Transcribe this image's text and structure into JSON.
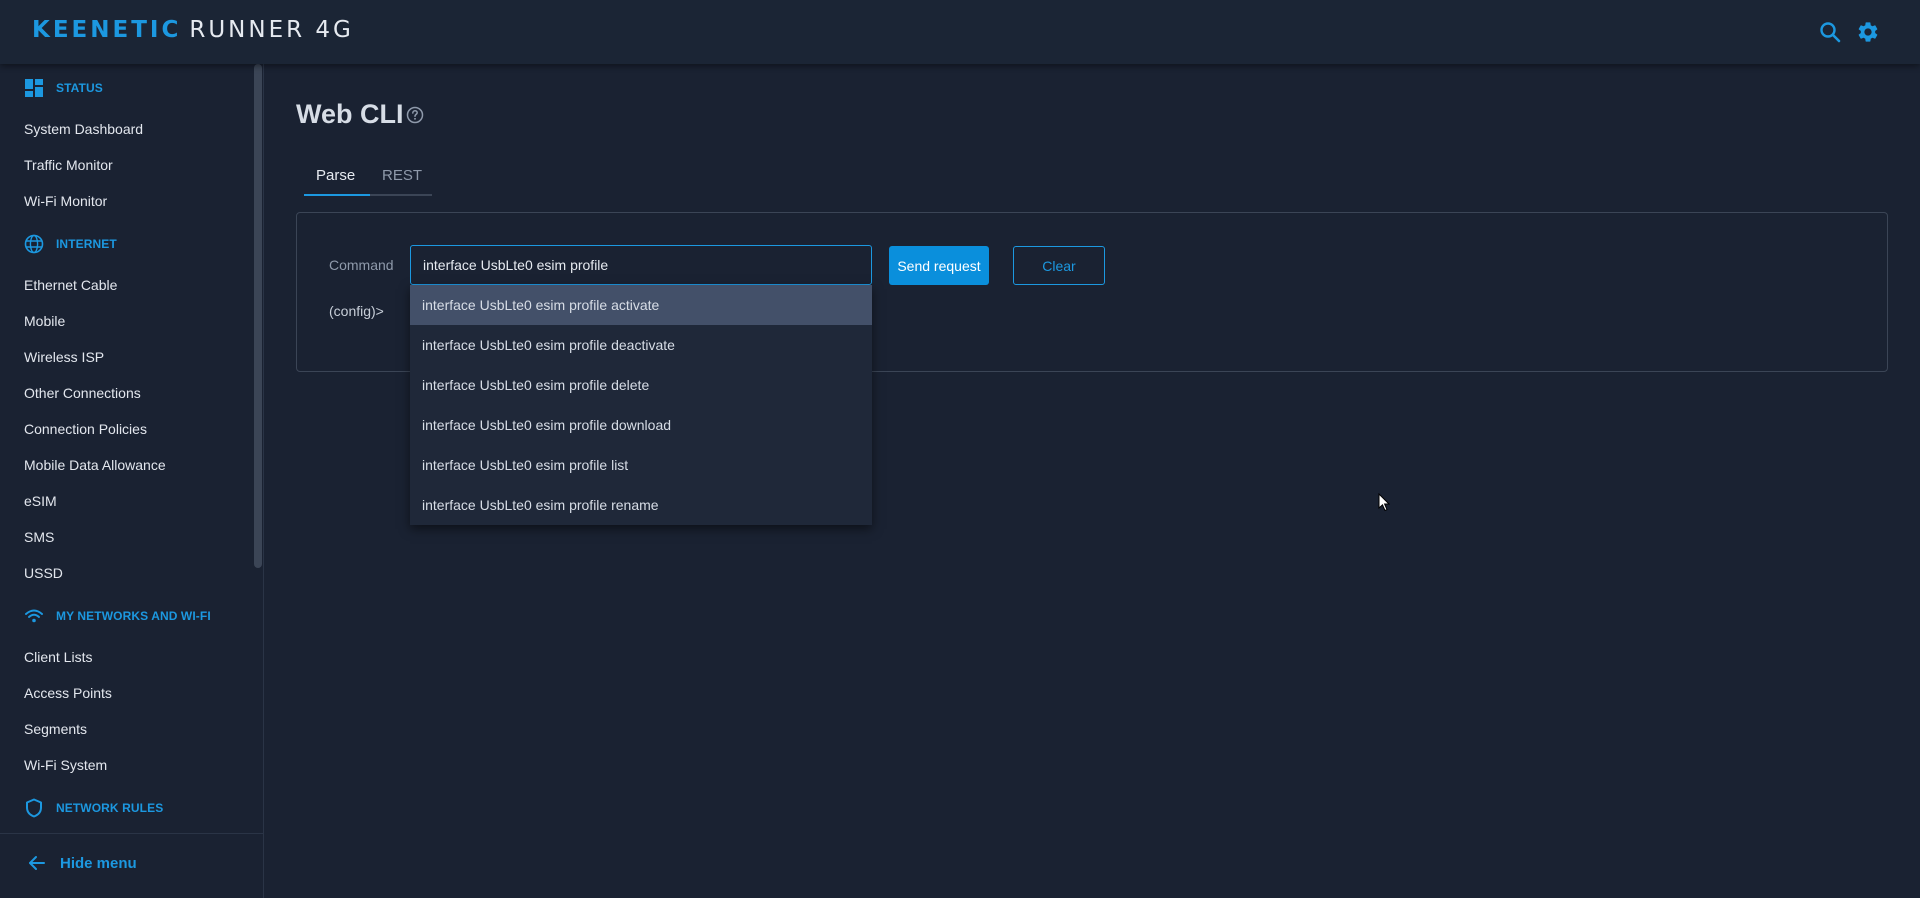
{
  "header": {
    "brand": "KEENETIC",
    "model": "RUNNER 4G",
    "search_icon": "search-icon",
    "settings_icon": "gear-icon"
  },
  "sidebar": {
    "sections": [
      {
        "label": "STATUS",
        "icon": "dashboard-icon",
        "items": [
          "System Dashboard",
          "Traffic Monitor",
          "Wi-Fi Monitor"
        ]
      },
      {
        "label": "INTERNET",
        "icon": "globe-icon",
        "items": [
          "Ethernet Cable",
          "Mobile",
          "Wireless ISP",
          "Other Connections",
          "Connection Policies",
          "Mobile Data Allowance",
          "eSIM",
          "SMS",
          "USSD"
        ]
      },
      {
        "label": "MY NETWORKS AND WI-FI",
        "icon": "wifi-icon",
        "items": [
          "Client Lists",
          "Access Points",
          "Segments",
          "Wi-Fi System"
        ]
      },
      {
        "label": "NETWORK RULES",
        "icon": "shield-icon",
        "items": []
      }
    ],
    "hide_menu": "Hide menu"
  },
  "main": {
    "title": "Web CLI",
    "tabs": [
      {
        "label": "Parse",
        "active": true
      },
      {
        "label": "REST",
        "active": false
      }
    ],
    "command_label": "Command",
    "command_value": "interface UsbLte0 esim profile",
    "send_label": "Send request",
    "clear_label": "Clear",
    "prompt": "(config)>",
    "suggestions": [
      "interface UsbLte0 esim profile activate",
      "interface UsbLte0 esim profile deactivate",
      "interface UsbLte0 esim profile delete",
      "interface UsbLte0 esim profile download",
      "interface UsbLte0 esim profile list",
      "interface UsbLte0 esim profile rename"
    ]
  },
  "colors": {
    "accent": "#1c98e0",
    "background": "#1a2232",
    "topbar": "#1b2535",
    "highlight": "#435069"
  }
}
